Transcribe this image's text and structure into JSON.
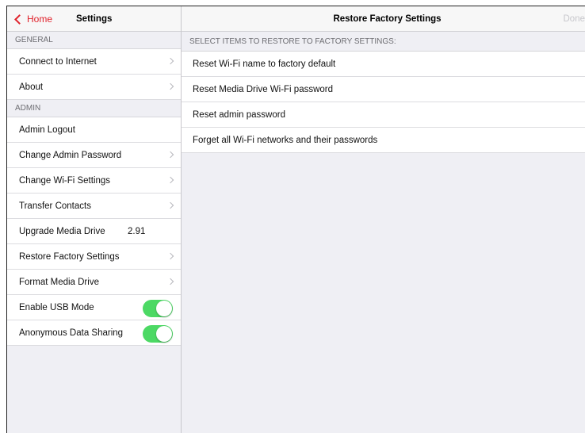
{
  "sidebar": {
    "back_label": "Home",
    "title": "Settings",
    "general_header": "GENERAL",
    "general_items": [
      {
        "label": "Connect to Internet"
      },
      {
        "label": "About"
      }
    ],
    "admin_header": "ADMIN",
    "admin_items": [
      {
        "label": "Admin Logout"
      },
      {
        "label": "Change Admin Password"
      },
      {
        "label": "Change Wi-Fi Settings"
      },
      {
        "label": "Transfer Contacts"
      },
      {
        "label": "Upgrade Media Drive",
        "value": "2.91"
      },
      {
        "label": "Restore Factory Settings"
      },
      {
        "label": "Format Media Drive"
      },
      {
        "label": "Enable USB Mode",
        "toggle": true
      },
      {
        "label": "Anonymous Data Sharing",
        "toggle": true
      }
    ]
  },
  "main": {
    "title": "Restore Factory Settings",
    "done_label": "Done",
    "section_header": "SELECT ITEMS TO RESTORE TO FACTORY SETTINGS:",
    "items": [
      {
        "label": "Reset Wi-Fi name to factory default"
      },
      {
        "label": "Reset Media Drive Wi-Fi password"
      },
      {
        "label": "Reset admin password"
      },
      {
        "label": "Forget all Wi-Fi networks and their passwords"
      }
    ]
  },
  "colors": {
    "accent": "#e0212a",
    "toggle_on": "#4cd964",
    "background": "#efeff4"
  }
}
